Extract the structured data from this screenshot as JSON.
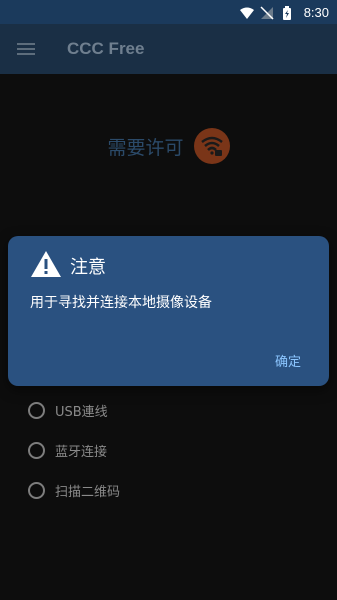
{
  "status_bar": {
    "time": "8:30"
  },
  "app_bar": {
    "title": "CCC Free"
  },
  "permission": {
    "title": "需要许可"
  },
  "options": [
    {
      "label": "USB連线"
    },
    {
      "label": "蓝牙连接"
    },
    {
      "label": "扫描二维码"
    }
  ],
  "dialog": {
    "title": "注意",
    "message": "用于寻找并连接本地摄像设备",
    "confirm_label": "确定"
  },
  "colors": {
    "status_bar": "#1b3a5c",
    "dialog_bg": "#2a5180",
    "warning_accent": "#7a3518",
    "confirm_text": "#8cc6ff"
  }
}
